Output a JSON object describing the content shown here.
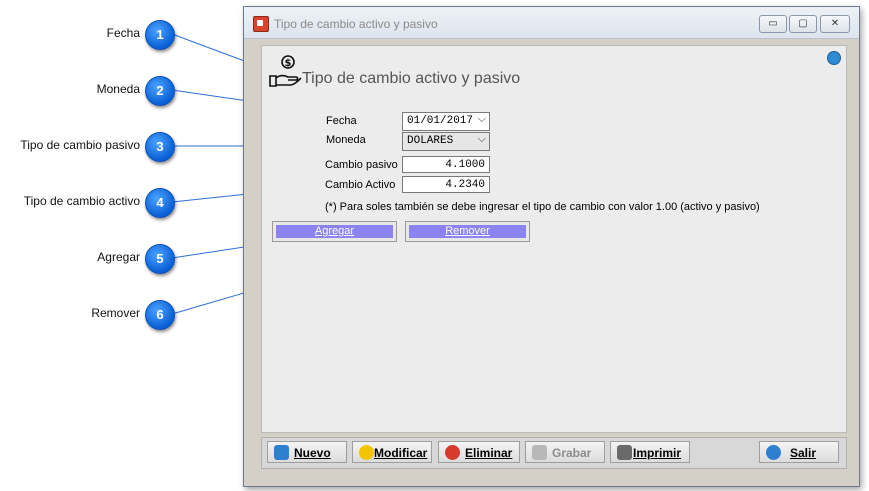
{
  "callouts": [
    {
      "number": "1",
      "label": "Fecha"
    },
    {
      "number": "2",
      "label": "Moneda"
    },
    {
      "number": "3",
      "label": "Tipo de cambio pasivo"
    },
    {
      "number": "4",
      "label": "Tipo de cambio activo"
    },
    {
      "number": "5",
      "label": "Agregar"
    },
    {
      "number": "6",
      "label": "Remover"
    }
  ],
  "window": {
    "title": "Tipo de cambio activo y pasivo",
    "controls": {
      "minimize": "▭",
      "maximize": "▢",
      "close": "✕"
    },
    "icon": "app-icon"
  },
  "panel": {
    "title": "Tipo de cambio activo y pasivo",
    "header_icon": "hand-dollar-icon"
  },
  "form": {
    "fecha": {
      "label": "Fecha",
      "value": "01/01/2017"
    },
    "moneda": {
      "label": "Moneda",
      "value": "DOLARES"
    },
    "cambio_pasivo": {
      "label": "Cambio pasivo",
      "value": "4.1000"
    },
    "cambio_activo": {
      "label": "Cambio Activo",
      "value": "4.2340"
    },
    "note": "(*) Para soles también se debe ingresar el tipo de cambio con valor 1.00 (activo y pasivo)"
  },
  "actions": {
    "add": "Agregar",
    "remove": "Remover"
  },
  "toolbar": {
    "nuevo": "Nuevo",
    "modificar": "Modificar",
    "eliminar": "Eliminar",
    "grabar": "Grabar",
    "imprimir": "Imprimir",
    "salir": "Salir"
  },
  "colors": {
    "badge": "#1473e6",
    "action_button": "#8b83f0",
    "line": "#2b6fd6"
  }
}
